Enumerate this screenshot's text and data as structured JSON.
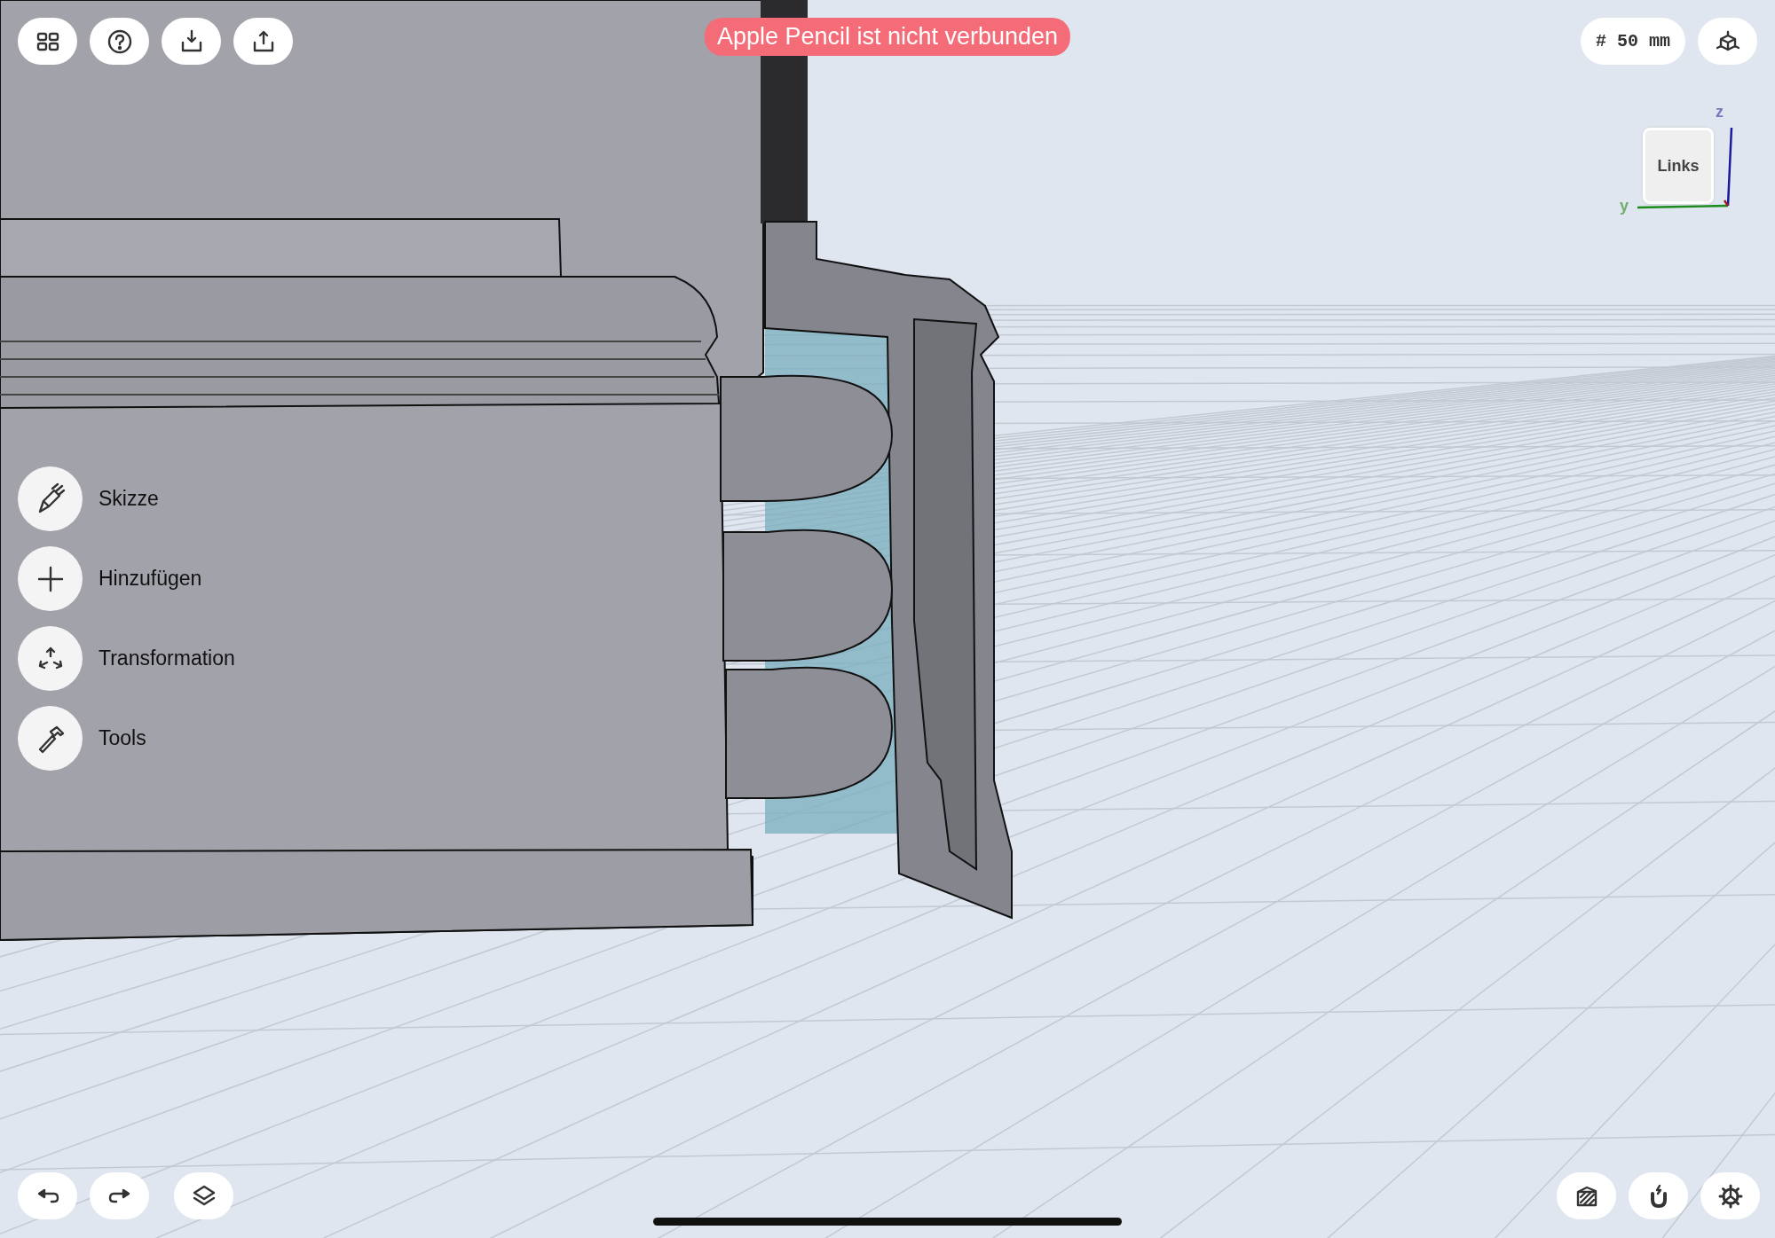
{
  "top_left_toolbar": [
    {
      "kind": "grid"
    },
    {
      "kind": "help"
    },
    {
      "kind": "import"
    },
    {
      "kind": "export"
    }
  ],
  "banner": {
    "text": "Apple Pencil ist nicht verbunden"
  },
  "grid_size": {
    "text": "# 50 mm"
  },
  "top_right_toolbar": [
    {
      "kind": "view"
    }
  ],
  "view_cube": {
    "face": "Links",
    "axes": [
      {
        "kind": "z",
        "label": "z"
      },
      {
        "kind": "y",
        "label": "y"
      }
    ]
  },
  "side_menu": [
    {
      "kind": "sketch",
      "label": "Skizze"
    },
    {
      "kind": "add",
      "label": "Hinzufügen"
    },
    {
      "kind": "transform",
      "label": "Transformation"
    },
    {
      "kind": "tools",
      "label": "Tools"
    }
  ],
  "bottom_left_toolbar": [
    {
      "kind": "undo"
    },
    {
      "kind": "redo"
    },
    {
      "kind": "layers"
    }
  ],
  "bottom_right_toolbar": [
    {
      "kind": "section"
    },
    {
      "kind": "snap"
    },
    {
      "kind": "settings"
    }
  ]
}
